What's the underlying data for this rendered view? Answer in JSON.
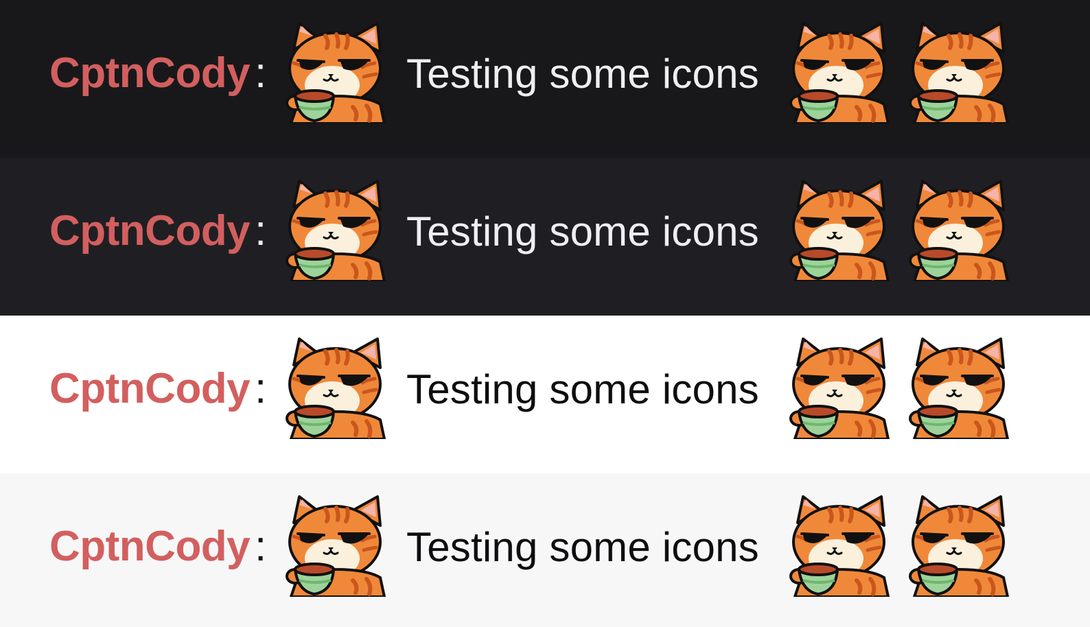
{
  "colors": {
    "username": "#d35f5f",
    "dark_bg_1": "#18181b",
    "dark_bg_2": "#1f1f23",
    "light_bg_1": "#ffffff",
    "light_bg_2": "#f7f7f8"
  },
  "emote": {
    "icon": "sleepy-cat-tea-emote-icon"
  },
  "rows": [
    {
      "theme": "dark",
      "username": "CptnCody",
      "separator": ":",
      "message": "Testing some icons"
    },
    {
      "theme": "dark",
      "username": "CptnCody",
      "separator": ":",
      "message": "Testing some icons"
    },
    {
      "theme": "light",
      "username": "CptnCody",
      "separator": ":",
      "message": "Testing some icons"
    },
    {
      "theme": "light",
      "username": "CptnCody",
      "separator": ":",
      "message": "Testing some icons"
    }
  ]
}
